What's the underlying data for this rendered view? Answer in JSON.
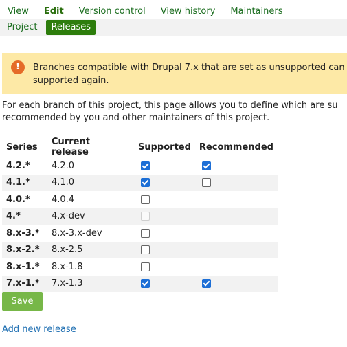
{
  "tabs": {
    "primary": [
      "View",
      "Edit",
      "Version control",
      "View history",
      "Maintainers"
    ],
    "active_primary": "Edit",
    "secondary": [
      "Project",
      "Releases"
    ],
    "active_secondary": "Releases"
  },
  "warning": {
    "icon": "!",
    "line1": "Branches compatible with Drupal 7.x that are set as unsupported can",
    "line2": "supported again."
  },
  "intro": {
    "line1": "For each branch of this project, this page allows you to define which are su",
    "line2": "recommended by you and other maintainers of this project."
  },
  "table": {
    "headers": [
      "Series",
      "Current release",
      "Supported",
      "Recommended"
    ],
    "rows": [
      {
        "series": "4.2.*",
        "release": "4.2.0",
        "supported": "checked",
        "recommended": "checked"
      },
      {
        "series": "4.1.*",
        "release": "4.1.0",
        "supported": "checked",
        "recommended": "unchecked"
      },
      {
        "series": "4.0.*",
        "release": "4.0.4",
        "supported": "unchecked",
        "recommended": "none"
      },
      {
        "series": "4.*",
        "release": "4.x-dev",
        "supported": "disabled",
        "recommended": "none"
      },
      {
        "series": "8.x-3.*",
        "release": "8.x-3.x-dev",
        "supported": "unchecked",
        "recommended": "none"
      },
      {
        "series": "8.x-2.*",
        "release": "8.x-2.5",
        "supported": "unchecked",
        "recommended": "none"
      },
      {
        "series": "8.x-1.*",
        "release": "8.x-1.8",
        "supported": "unchecked",
        "recommended": "none"
      },
      {
        "series": "7.x-1.*",
        "release": "7.x-1.3",
        "supported": "checked",
        "recommended": "checked"
      }
    ]
  },
  "save_label": "Save",
  "add_release_label": "Add new release",
  "colors": {
    "tab_link": "#1b6d1f",
    "active_subtab_bg": "#2d7d0c",
    "warning_bg": "#fde9a6",
    "warning_icon": "#e56b28",
    "checkbox_checked": "#1d6fd6",
    "save_button": "#77b748",
    "link": "#1f6fb2"
  }
}
